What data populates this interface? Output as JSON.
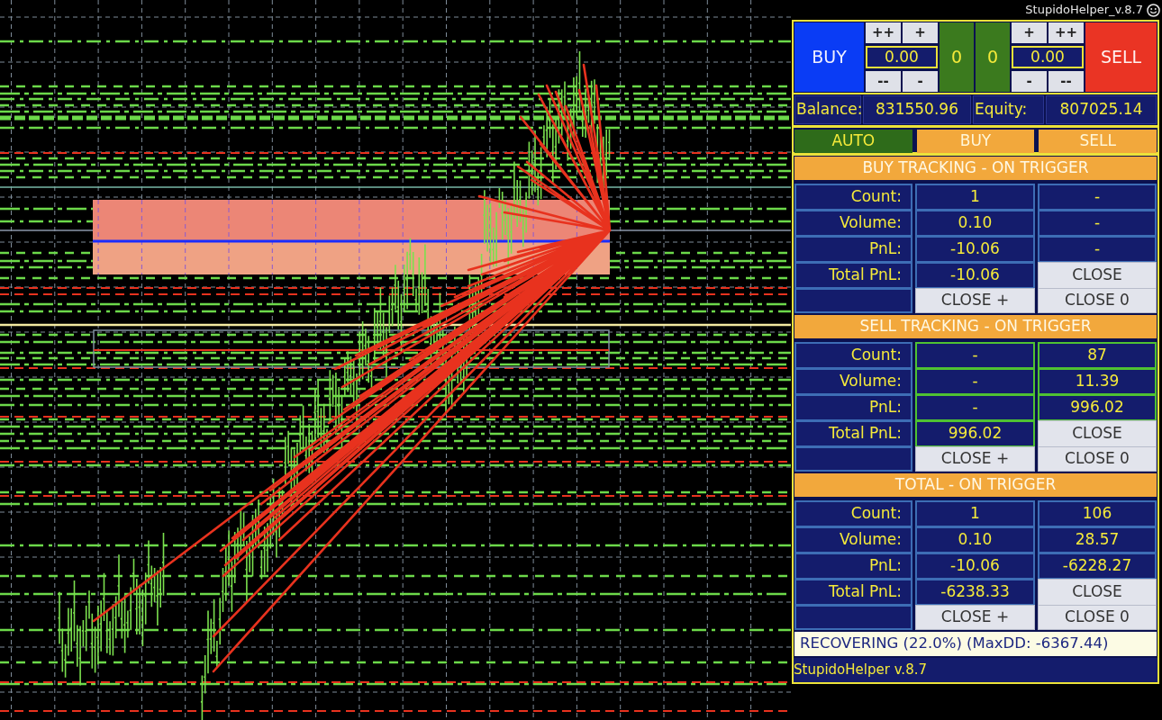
{
  "title": {
    "text": "StupidoHelper_v.8.7"
  },
  "trade_bar": {
    "buy": {
      "label": "BUY"
    },
    "buy_lot": {
      "up": [
        "++",
        "+"
      ],
      "value": "0.00",
      "down": [
        "--",
        "-"
      ]
    },
    "counters": [
      "0",
      "0"
    ],
    "sell_lot": {
      "up": [
        "+",
        "++"
      ],
      "value": "0.00",
      "down": [
        "-",
        "--"
      ]
    },
    "sell": {
      "label": "SELL"
    }
  },
  "account": [
    {
      "label": "Balance:",
      "value": "831550.96"
    },
    {
      "label": "Equity:",
      "value": "807025.14"
    }
  ],
  "modes": [
    {
      "label": "AUTO",
      "selected": true
    },
    {
      "label": "BUY",
      "selected": false
    },
    {
      "label": "SELL",
      "selected": false
    }
  ],
  "sections": [
    {
      "title": "BUY TRACKING - ON TRIGGER",
      "color": "#3d6db5",
      "rows": [
        {
          "kind": "values",
          "label": "Count:",
          "values": [
            "1",
            "-"
          ]
        },
        {
          "kind": "values",
          "label": "Volume:",
          "values": [
            "0.10",
            "-"
          ]
        },
        {
          "kind": "values",
          "label": "PnL:",
          "values": [
            "-10.06",
            "-"
          ]
        },
        {
          "kind": "total",
          "label": "Total PnL:",
          "value": "-10.06",
          "button": "CLOSE"
        }
      ],
      "buttons": [
        "CLOSE +",
        "CLOSE 0"
      ]
    },
    {
      "title": "SELL TRACKING - ON TRIGGER",
      "color": "#4fc232",
      "rows": [
        {
          "kind": "values",
          "label": "Count:",
          "values": [
            "-",
            "87"
          ]
        },
        {
          "kind": "values",
          "label": "Volume:",
          "values": [
            "-",
            "11.39"
          ]
        },
        {
          "kind": "values",
          "label": "PnL:",
          "values": [
            "-",
            "996.02"
          ]
        },
        {
          "kind": "total",
          "label": "Total PnL:",
          "value": "996.02",
          "button": "CLOSE"
        }
      ],
      "buttons": [
        "CLOSE +",
        "CLOSE 0"
      ]
    },
    {
      "title": "TOTAL - ON TRIGGER",
      "color": "#3d6db5",
      "rows": [
        {
          "kind": "values",
          "label": "Count:",
          "values": [
            "1",
            "106"
          ]
        },
        {
          "kind": "values",
          "label": "Volume:",
          "values": [
            "0.10",
            "28.57"
          ]
        },
        {
          "kind": "values",
          "label": "PnL:",
          "values": [
            "-10.06",
            "-6228.27"
          ]
        },
        {
          "kind": "total",
          "label": "Total PnL:",
          "value": "-6238.33",
          "button": "CLOSE"
        }
      ],
      "buttons": [
        "CLOSE +",
        "CLOSE 0"
      ]
    }
  ],
  "status": {
    "text": "RECOVERING (22.0%) (MaxDD: -6367.44)"
  },
  "footer": {
    "text": "StupidoHelper v.8.7"
  }
}
